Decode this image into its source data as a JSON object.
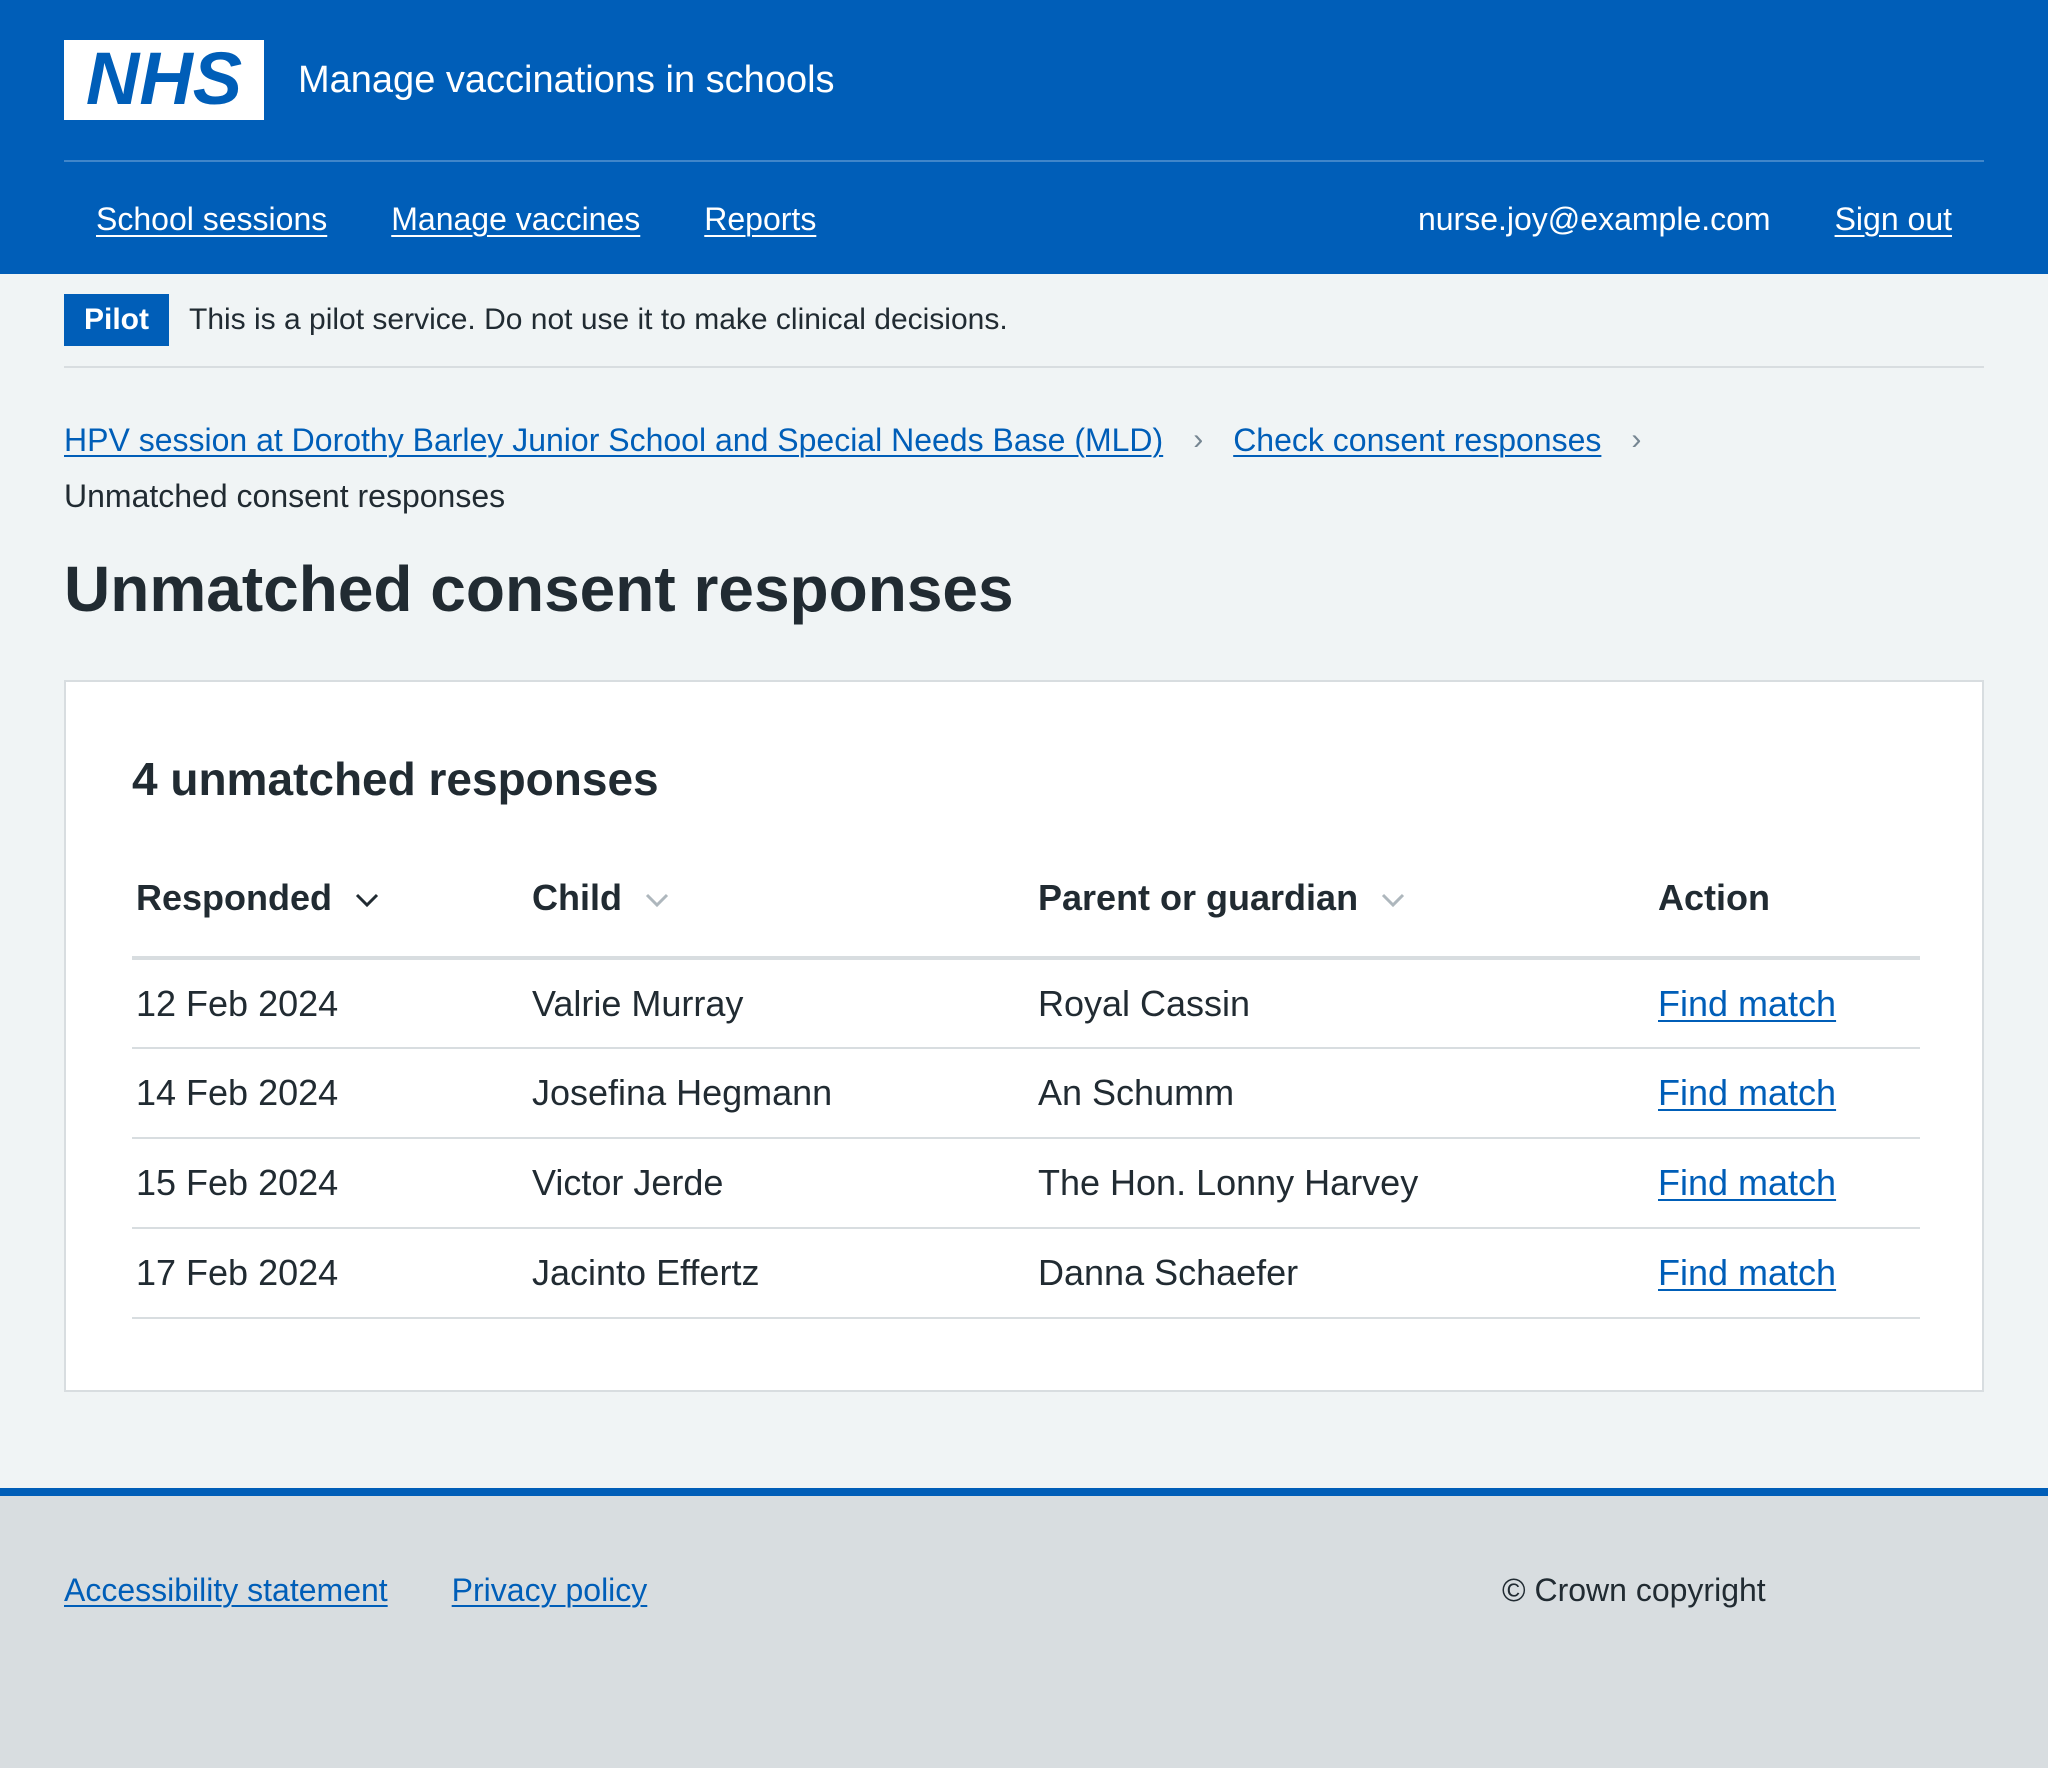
{
  "header": {
    "logo_text": "NHS",
    "service_name": "Manage vaccinations in schools",
    "nav": [
      "School sessions",
      "Manage vaccines",
      "Reports"
    ],
    "user_email": "nurse.joy@example.com",
    "sign_out": "Sign out"
  },
  "pilot": {
    "tag": "Pilot",
    "text": "This is a pilot service. Do not use it to make clinical decisions."
  },
  "breadcrumb": {
    "items": [
      "HPV session at Dorothy Barley Junior School and Special Needs Base (MLD)",
      "Check consent responses"
    ],
    "current": "Unmatched consent responses"
  },
  "page_title": "Unmatched consent responses",
  "card": {
    "title": "4 unmatched responses",
    "columns": [
      "Responded",
      "Child",
      "Parent or guardian",
      "Action"
    ],
    "rows": [
      {
        "responded": "12 Feb 2024",
        "child": "Valrie Murray",
        "parent": "Royal Cassin",
        "action": "Find match"
      },
      {
        "responded": "14 Feb 2024",
        "child": "Josefina Hegmann",
        "parent": "An Schumm",
        "action": "Find match"
      },
      {
        "responded": "15 Feb 2024",
        "child": "Victor Jerde",
        "parent": "The Hon. Lonny Harvey",
        "action": "Find match"
      },
      {
        "responded": "17 Feb 2024",
        "child": "Jacinto Effertz",
        "parent": "Danna Schaefer",
        "action": "Find match"
      }
    ]
  },
  "footer": {
    "links": [
      "Accessibility statement",
      "Privacy policy"
    ],
    "copyright": "© Crown copyright"
  },
  "colors": {
    "brand_blue": "#005eb8",
    "page_bg": "#f0f4f5",
    "border": "#d8dde0",
    "text": "#212b32"
  }
}
